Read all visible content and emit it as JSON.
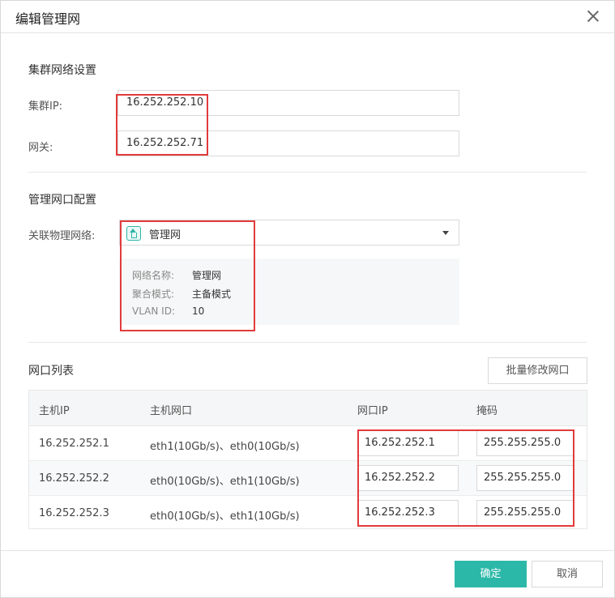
{
  "dialog": {
    "title": "编辑管理网"
  },
  "cluster": {
    "section_title": "集群网络设置",
    "ip_label": "集群IP:",
    "ip_value": "16.252.252.10",
    "gateway_label": "网关:",
    "gateway_value": "16.252.252.71"
  },
  "mgmt": {
    "section_title": "管理网口配置",
    "physical_label": "关联物理网络:",
    "physical_value": "管理网",
    "info": [
      {
        "label": "网络名称:",
        "value": "管理网"
      },
      {
        "label": "聚合模式:",
        "value": "主备模式"
      },
      {
        "label": "VLAN ID:",
        "value": "10"
      }
    ]
  },
  "ports": {
    "section_title": "网口列表",
    "batch_button": "批量修改网口",
    "columns": [
      "主机IP",
      "主机网口",
      "网口IP",
      "掩码"
    ],
    "rows": [
      {
        "host_ip": "16.252.252.1",
        "host_ports": "eth1(10Gb/s)、eth0(10Gb/s)",
        "port_ip": "16.252.252.1",
        "mask": "255.255.255.0"
      },
      {
        "host_ip": "16.252.252.2",
        "host_ports": "eth0(10Gb/s)、eth1(10Gb/s)",
        "port_ip": "16.252.252.2",
        "mask": "255.255.255.0"
      },
      {
        "host_ip": "16.252.252.3",
        "host_ports": "eth0(10Gb/s)、eth1(10Gb/s)",
        "port_ip": "16.252.252.3",
        "mask": "255.255.255.0"
      }
    ]
  },
  "footer": {
    "confirm": "确定",
    "cancel": "取消"
  },
  "colors": {
    "accent": "#2cb8a9",
    "highlight": "#e23b3b"
  },
  "icons": {
    "close": "close-icon",
    "network": "network-home-icon",
    "dropdown": "caret-down-icon"
  }
}
